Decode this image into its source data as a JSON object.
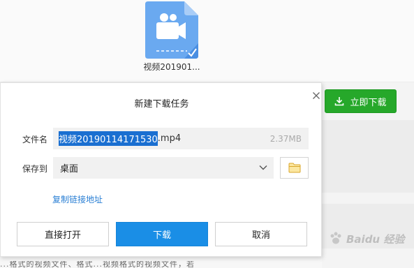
{
  "background": {
    "file_name": "视频201901...",
    "download_now_label": "立即下载",
    "watermark_text": "Baidu 经验",
    "bottom_text": "...格式的视频文件、格式...视频格式的视频文件，若"
  },
  "dialog": {
    "title": "新建下载任务",
    "filename_label": "文件名",
    "filename_selected": "视频20190114171530",
    "filename_ext": ".mp4",
    "file_size": "2.37MB",
    "saveto_label": "保存到",
    "saveto_value": "桌面",
    "copy_link_label": "复制链接地址",
    "open_directly_label": "直接打开",
    "download_label": "下载",
    "cancel_label": "取消"
  },
  "colors": {
    "accent_blue": "#1a8ee6",
    "download_green": "#26a82a",
    "file_icon_blue": "#6aa9f0"
  }
}
